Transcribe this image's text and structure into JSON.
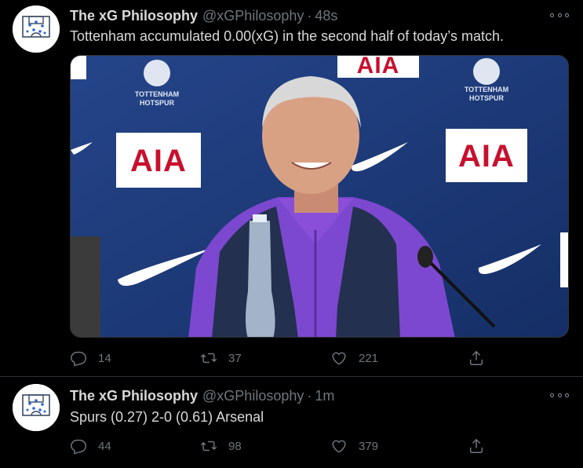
{
  "tweets": [
    {
      "author_name": "The xG Philosophy",
      "handle": "@xGPhilosophy",
      "separator": "·",
      "time": "48s",
      "text": "Tottenham accumulated 0.00(xG) in the second half of today’s match.",
      "media": {
        "sponsor_text": "AIA",
        "club_text_line1": "TOTTENHAM",
        "club_text_line2": "HOTSPUR"
      },
      "reply_count": "14",
      "retweet_count": "37",
      "like_count": "221"
    },
    {
      "author_name": "The xG Philosophy",
      "handle": "@xGPhilosophy",
      "separator": "·",
      "time": "1m",
      "text": "Spurs (0.27) 2-0 (0.61) Arsenal",
      "reply_count": "44",
      "retweet_count": "98",
      "like_count": "379"
    }
  ],
  "icons": {
    "reply": "reply-icon",
    "retweet": "retweet-icon",
    "like": "heart-icon",
    "share": "share-icon",
    "more": "more-icon"
  },
  "colors": {
    "background": "#000000",
    "text": "#d9d9d9",
    "muted": "#6e767d",
    "divider": "#2f3336",
    "sponsor_red": "#c8102e",
    "backdrop_navy": "#1e3a78",
    "shirt_purple": "#8a4fd8"
  }
}
